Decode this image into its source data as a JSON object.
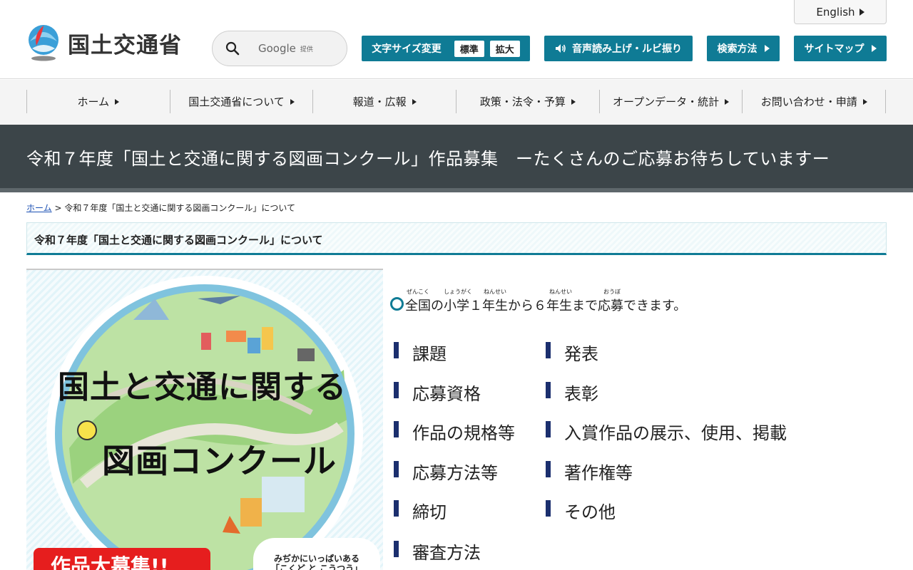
{
  "header": {
    "logo_text": "国土交通省",
    "english_label": "English",
    "search": {
      "brand": "Google",
      "provided": "提供"
    },
    "font_size": {
      "label": "文字サイズ変更",
      "standard": "標準",
      "large": "拡大"
    },
    "speech_label": "音声読み上げ・ルビ振り",
    "search_method_label": "検索方法",
    "sitemap_label": "サイトマップ"
  },
  "nav": {
    "items": [
      "ホーム",
      "国土交通省について",
      "報道・広報",
      "政策・法令・予算",
      "オープンデータ・統計",
      "お問い合わせ・申請"
    ]
  },
  "page_title": "令和７年度「国土と交通に関する図画コンクール」作品募集　ーたくさんのご応募お待ちしていますー",
  "breadcrumb": {
    "home": "ホーム",
    "separator": ">",
    "current": "令和７年度「国土と交通に関する図画コンクール」について"
  },
  "section_heading": "令和７年度「国土と交通に関する図画コンクール」について",
  "poster": {
    "title_line1": "国土と交通に関する",
    "title_line2": "図画コンクール",
    "banner": "作品大募集!!",
    "sub_line1": "みぢかにいっぱいある",
    "sub_line2": "「こくど と こうつう」"
  },
  "intro": {
    "text": "全国の小学１年生から６年生まで応募できます。",
    "ruby": [
      "ぜんこく",
      "しょうがく",
      "ねんせい",
      "ねんせい",
      "おうぼ"
    ]
  },
  "links": {
    "left": [
      "課題",
      "応募資格",
      "作品の規格等",
      "応募方法等",
      "締切",
      "審査方法"
    ],
    "right": [
      "発表",
      "表彰",
      "入賞作品の展示、使用、掲載",
      "著作権等",
      "その他"
    ]
  },
  "colors": {
    "teal": "#0f7b95",
    "title_bar": "#3c4549",
    "navy_bar": "#1b2f6e",
    "poster_red": "#e61e1e"
  }
}
